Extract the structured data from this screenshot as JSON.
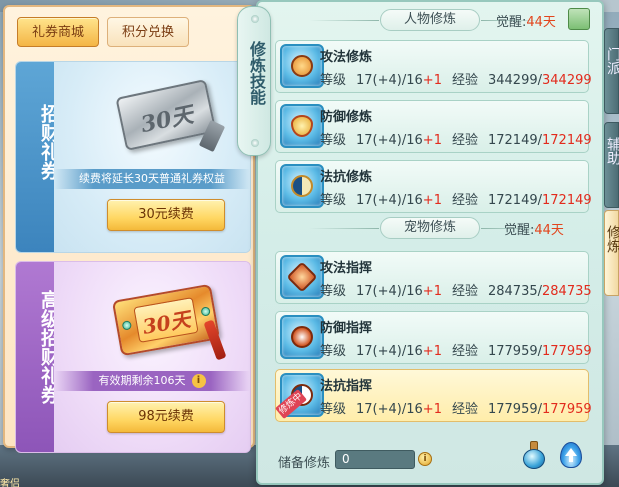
{
  "shop": {
    "tabs": [
      {
        "label": "礼券商城",
        "active": true
      },
      {
        "label": "积分兑换",
        "active": false
      }
    ],
    "coupons": [
      {
        "side_label": "招财礼券",
        "ticket_text": "30天",
        "info": "续费将延长30天普通礼券权益",
        "button": "30元续费"
      },
      {
        "side_label": "高级招财礼券",
        "ticket_text": "30天",
        "info": "有效期剩余106天",
        "button": "98元续费"
      }
    ]
  },
  "cultivation": {
    "tab_label": "修炼技能",
    "character": {
      "title": "人物修炼",
      "awaken_label": "觉醒:",
      "awaken_days": "44天",
      "skills": [
        {
          "name": "攻法修炼",
          "level_label": "等级",
          "level": "17(+4)/16",
          "bonus": "+1",
          "exp_label": "经验",
          "exp": "344299/",
          "exp_max": "344299",
          "icon": "mage-icon"
        },
        {
          "name": "防御修炼",
          "level_label": "等级",
          "level": "17(+4)/16",
          "bonus": "+1",
          "exp_label": "经验",
          "exp": "172149/",
          "exp_max": "172149",
          "icon": "shield-icon"
        },
        {
          "name": "法抗修炼",
          "level_label": "等级",
          "level": "17(+4)/16",
          "bonus": "+1",
          "exp_label": "经验",
          "exp": "172149/",
          "exp_max": "172149",
          "icon": "taiji-icon"
        }
      ]
    },
    "pet": {
      "title": "宠物修炼",
      "awaken_label": "觉醒:",
      "awaken_days": "44天",
      "skills": [
        {
          "name": "攻法指挥",
          "level_label": "等级",
          "level": "17(+4)/16",
          "bonus": "+1",
          "exp_label": "经验",
          "exp": "284735/",
          "exp_max": "284735",
          "icon": "paw-attack-icon"
        },
        {
          "name": "防御指挥",
          "level_label": "等级",
          "level": "17(+4)/16",
          "bonus": "+1",
          "exp_label": "经验",
          "exp": "177959/",
          "exp_max": "177959",
          "icon": "paw-defense-icon"
        },
        {
          "name": "法抗指挥",
          "level_label": "等级",
          "level": "17(+4)/16",
          "bonus": "+1",
          "exp_label": "经验",
          "exp": "177959/",
          "exp_max": "177959",
          "icon": "paw-resist-icon",
          "badge": "修炼中"
        }
      ]
    },
    "reserve": {
      "label": "储备修炼",
      "value": "0"
    }
  },
  "right_tabs": [
    {
      "label": "门派"
    },
    {
      "label": "辅助"
    },
    {
      "label": "修炼"
    }
  ],
  "background": {
    "corner_text": "奢侣"
  },
  "colors": {
    "accent_red": "#e22b1d",
    "panel_teal": "#d4ede8",
    "button_gold": "#ffd763"
  }
}
